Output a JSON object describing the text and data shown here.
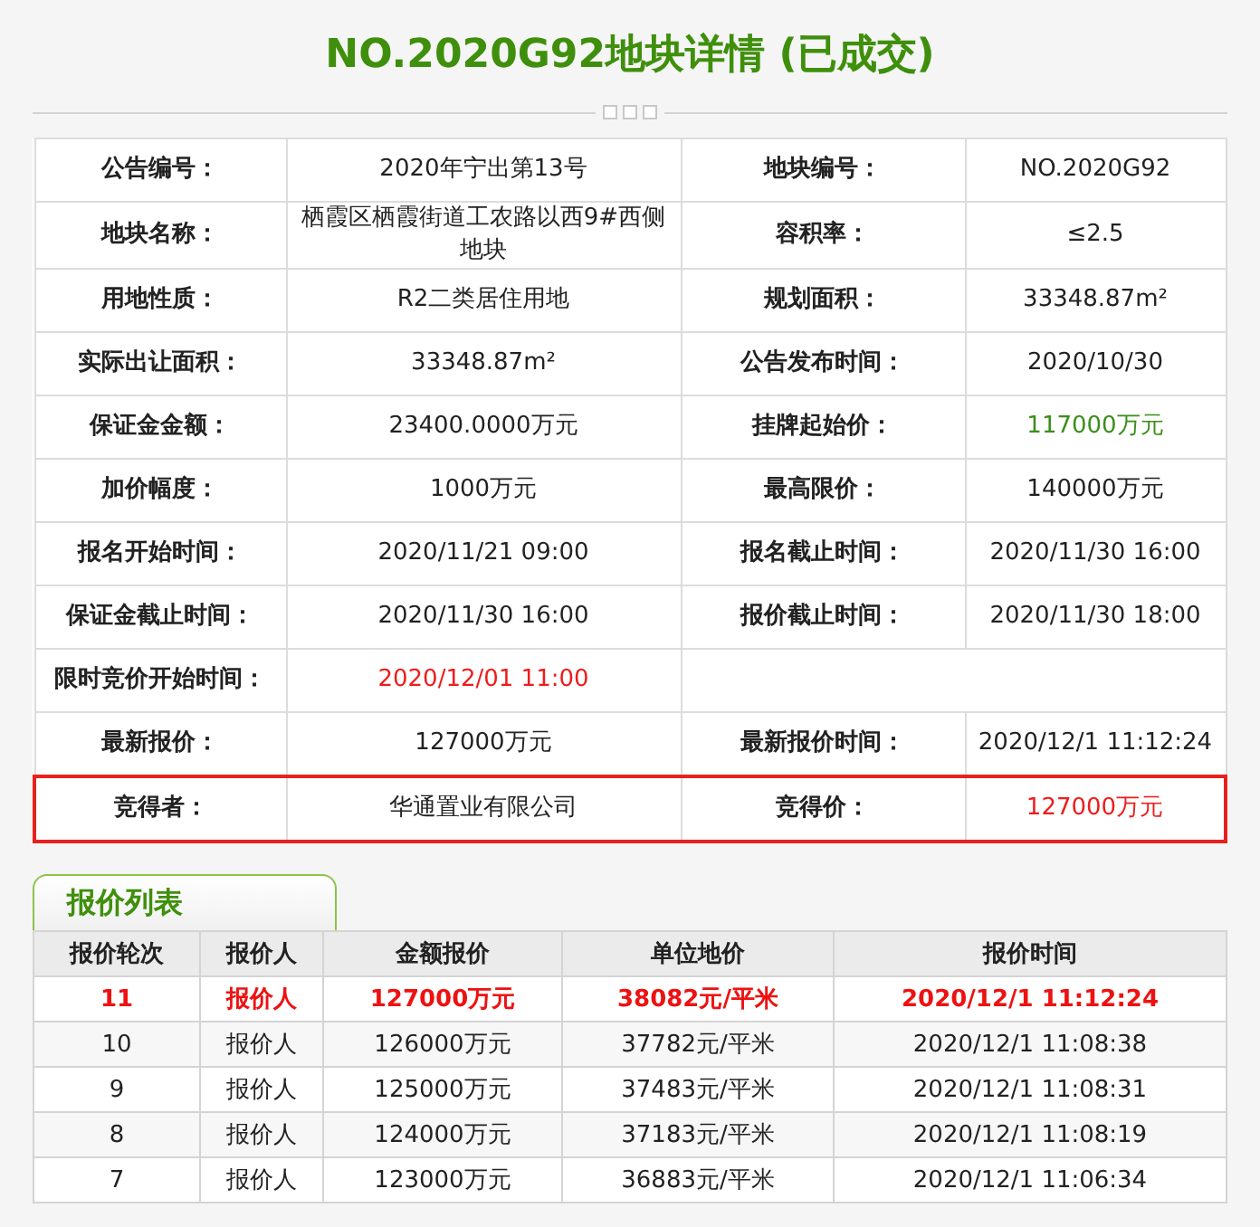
{
  "title": "NO.2020G92地块详情 (已成交)",
  "details": [
    {
      "highlighted": false,
      "cells": [
        {
          "label": "公告编号：",
          "value": "2020年宁出第13号"
        },
        {
          "label": "地块编号：",
          "value": "NO.2020G92"
        }
      ]
    },
    {
      "highlighted": false,
      "cells": [
        {
          "label": "地块名称：",
          "value": "栖霞区栖霞街道工农路以西9#西侧地块"
        },
        {
          "label": "容积率：",
          "value": "≤2.5"
        }
      ]
    },
    {
      "highlighted": false,
      "cells": [
        {
          "label": "用地性质：",
          "value": "R2二类居住用地"
        },
        {
          "label": "规划面积：",
          "value": "33348.87m²"
        }
      ]
    },
    {
      "highlighted": false,
      "cells": [
        {
          "label": "实际出让面积：",
          "value": "33348.87m²"
        },
        {
          "label": "公告发布时间：",
          "value": "2020/10/30"
        }
      ]
    },
    {
      "highlighted": false,
      "cells": [
        {
          "label": "保证金金额：",
          "value": "23400.0000万元"
        },
        {
          "label": "挂牌起始价：",
          "value": "117000万元",
          "color": "#3b8e1a"
        }
      ]
    },
    {
      "highlighted": false,
      "cells": [
        {
          "label": "加价幅度：",
          "value": "1000万元"
        },
        {
          "label": "最高限价：",
          "value": "140000万元"
        }
      ]
    },
    {
      "highlighted": false,
      "cells": [
        {
          "label": "报名开始时间：",
          "value": "2020/11/21 09:00"
        },
        {
          "label": "报名截止时间：",
          "value": "2020/11/30 16:00"
        }
      ]
    },
    {
      "highlighted": false,
      "cells": [
        {
          "label": "保证金截止时间：",
          "value": "2020/11/30 16:00"
        },
        {
          "label": "报价截止时间：",
          "value": "2020/11/30 18:00"
        }
      ]
    },
    {
      "highlighted": false,
      "cells": [
        {
          "label": "限时竞价开始时间：",
          "value": "2020/12/01 11:00",
          "color": "#ee1c1c"
        }
      ]
    },
    {
      "highlighted": false,
      "cells": [
        {
          "label": "最新报价：",
          "value": "127000万元"
        },
        {
          "label": "最新报价时间：",
          "value": "2020/12/1 11:12:24"
        }
      ]
    },
    {
      "highlighted": true,
      "cells": [
        {
          "label": "竞得者：",
          "value": "华通置业有限公司"
        },
        {
          "label": "竞得价：",
          "value": "127000万元",
          "color": "#ee1c1c"
        }
      ]
    }
  ],
  "bids_tab": "报价列表",
  "bids": {
    "columns": [
      "报价轮次",
      "报价人",
      "金额报价",
      "单位地价",
      "报价时间"
    ],
    "rows": [
      {
        "latest": true,
        "cells": [
          "11",
          "报价人",
          "127000万元",
          "38082元/平米",
          "2020/12/1 11:12:24"
        ]
      },
      {
        "latest": false,
        "cells": [
          "10",
          "报价人",
          "126000万元",
          "37782元/平米",
          "2020/12/1 11:08:38"
        ]
      },
      {
        "latest": false,
        "cells": [
          "9",
          "报价人",
          "125000万元",
          "37483元/平米",
          "2020/12/1 11:08:31"
        ]
      },
      {
        "latest": false,
        "cells": [
          "8",
          "报价人",
          "124000万元",
          "37183元/平米",
          "2020/12/1 11:08:19"
        ]
      },
      {
        "latest": false,
        "cells": [
          "7",
          "报价人",
          "123000万元",
          "36883元/平米",
          "2020/12/1 11:06:34"
        ]
      }
    ]
  }
}
